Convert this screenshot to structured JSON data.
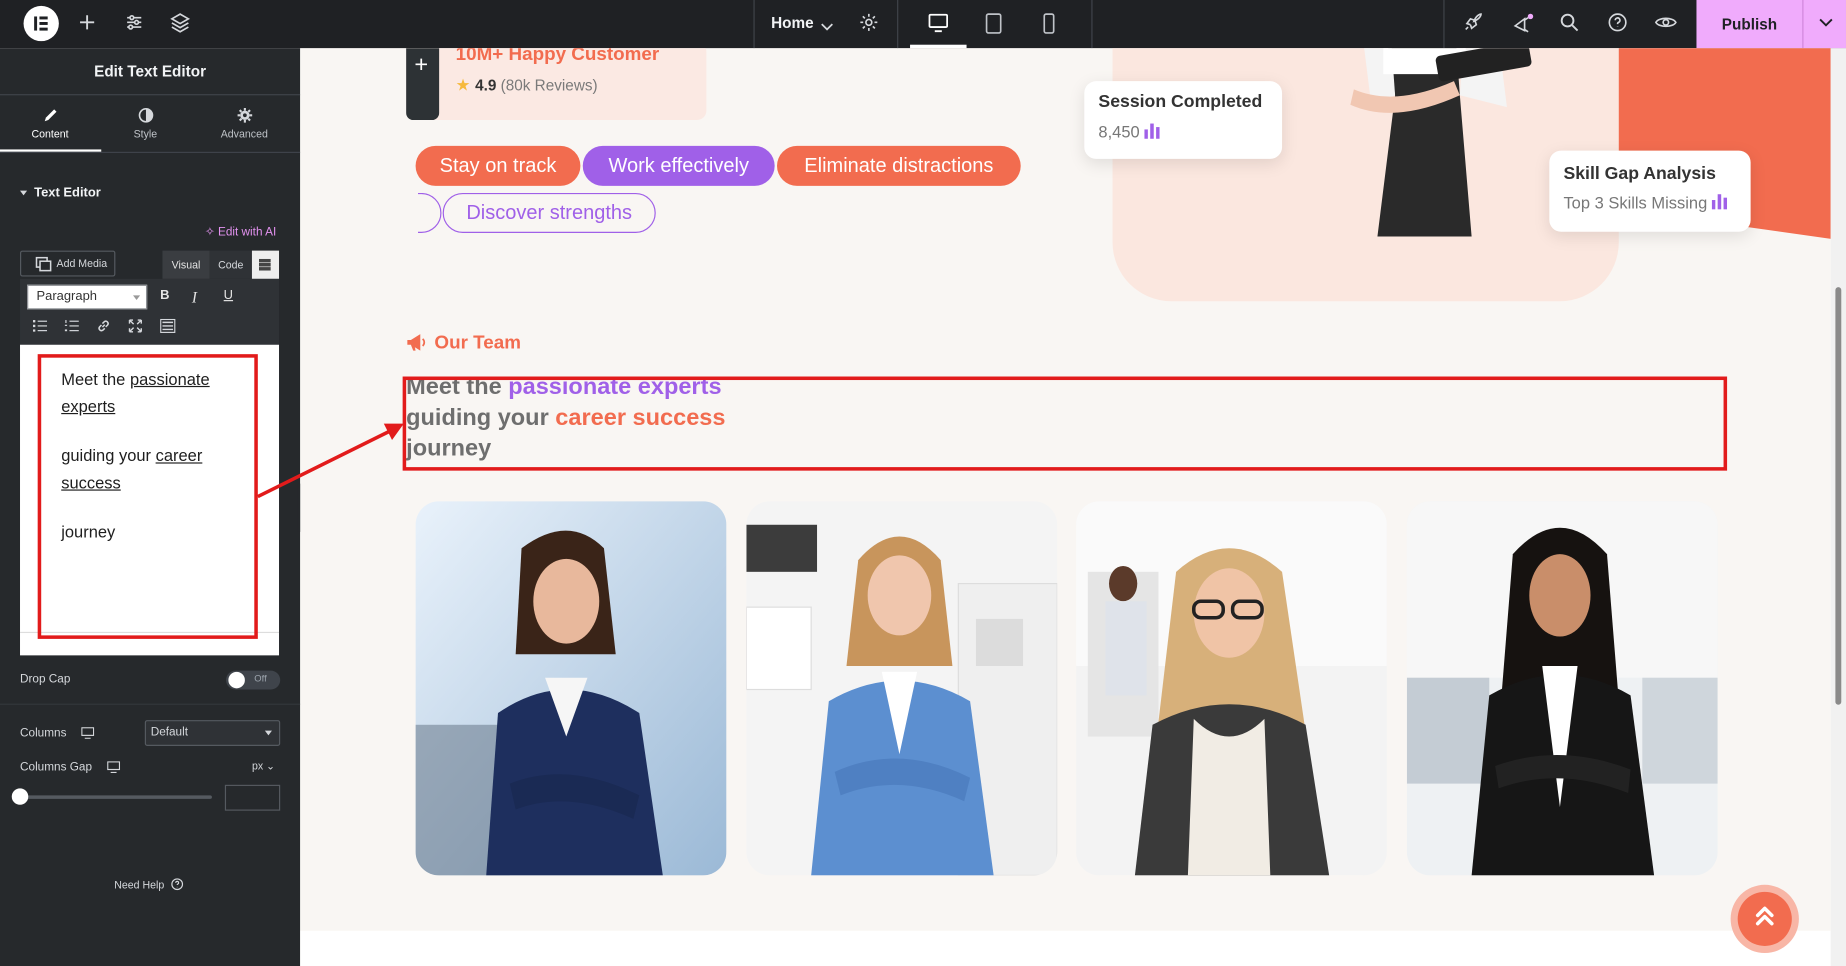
{
  "topbar": {
    "page_select": "Home",
    "publish_label": "Publish",
    "icons": [
      "elementor-logo-icon",
      "add-icon",
      "settings-sliders-icon",
      "layers-icon",
      "page-settings-icon",
      "desktop-icon",
      "tablet-icon",
      "mobile-icon",
      "rocket-icon",
      "notifications-icon",
      "search-icon",
      "help-icon",
      "preview-icon",
      "chevron-down-icon"
    ]
  },
  "panel": {
    "title": "Edit Text Editor",
    "tabs": [
      {
        "label": "Content"
      },
      {
        "label": "Style"
      },
      {
        "label": "Advanced"
      }
    ],
    "section_title": "Text Editor",
    "edit_ai": "Edit with AI",
    "add_media": "Add Media",
    "visual_tab": "Visual",
    "code_tab": "Code",
    "format_select": "Paragraph",
    "bold": "B",
    "italic": "I",
    "underline": "U",
    "editor": {
      "p1_plain": "Meet the ",
      "p1_u1": "passionate",
      "p1_u2": "experts",
      "p2_plain": "guiding your ",
      "p2_u1": "career",
      "p2_u2": "success",
      "p3": "journey"
    },
    "drop_cap_label": "Drop Cap",
    "drop_cap_value": "Off",
    "columns_label": "Columns",
    "columns_value": "Default",
    "columns_gap_label": "Columns Gap",
    "columns_gap_unit": "px",
    "need_help": "Need Help"
  },
  "canvas": {
    "happy_title": "10M+ Happy Customer",
    "rating_value": "4.9",
    "rating_reviews": "(80k Reviews)",
    "pills": [
      "Stay on track",
      "Work effectively",
      "Eliminate distractions",
      "Discover strengths"
    ],
    "session_card": {
      "title": "Session Completed",
      "value": "8,450"
    },
    "skill_card": {
      "title": "Skill Gap Analysis",
      "value": "Top 3 Skills Missing"
    },
    "team_label": "Our Team",
    "headline": {
      "l1a": "Meet the ",
      "l1b": "passionate experts",
      "l2a": "guiding your ",
      "l2b": "career success",
      "l3": "journey"
    }
  },
  "colors": {
    "accent_orange": "#f26c4f",
    "accent_purple": "#a060e8",
    "publish_pink": "#f0abfc",
    "panel_bg": "#26292c",
    "annotation_red": "#e21b1b"
  }
}
